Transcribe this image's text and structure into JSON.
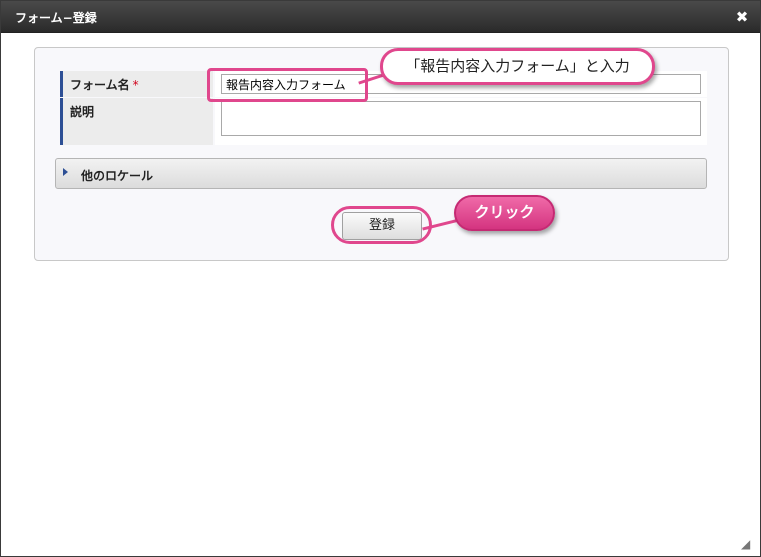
{
  "dialog": {
    "title": "フォーム−登録",
    "close_glyph": "✖"
  },
  "form": {
    "name_label": "フォーム名",
    "required_mark": "*",
    "name_value": "報告内容入力フォーム",
    "description_label": "説明",
    "description_value": "",
    "other_locale_label": "他のロケール",
    "register_button": "登録"
  },
  "annotations": {
    "input_callout": "「報告内容入力フォーム」と入力",
    "click_callout": "クリック"
  },
  "colors": {
    "highlight": "#e0478d",
    "label_accent": "#2d4f95",
    "titlebar": "#2a2a2a"
  }
}
